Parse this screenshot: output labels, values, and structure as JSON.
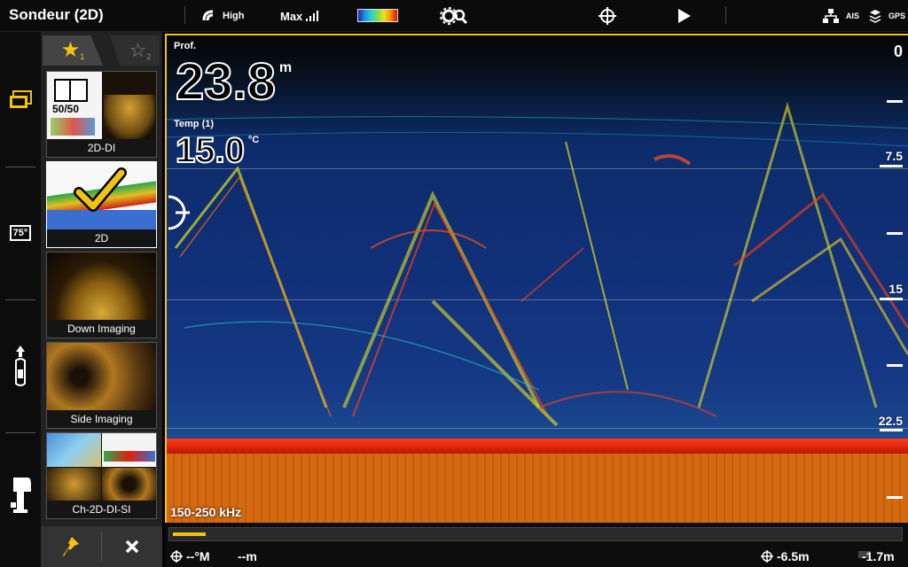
{
  "app": {
    "title": "Sondeur (2D)",
    "sensitivity": "High",
    "range_mode": "Max",
    "ais_label": "AIS",
    "gps_label": "GPS"
  },
  "favorites": {
    "tab1_number": "1",
    "tab2_number": "2",
    "tiles": [
      {
        "label": "2D-DI",
        "overlay": "50/50"
      },
      {
        "label": "2D"
      },
      {
        "label": "Down Imaging"
      },
      {
        "label": "Side Imaging"
      },
      {
        "label": "Ch-2D-DI-SI"
      }
    ]
  },
  "rail": {
    "temp_badge": "75°"
  },
  "sonar": {
    "depth_label": "Prof.",
    "depth_value": "23.8",
    "depth_unit": "m",
    "temp_label": "Temp (1)",
    "temp_value": "15.0",
    "temp_unit": "°C",
    "frequency": "150-250 kHz",
    "scale": [
      "0",
      "7.5",
      "15",
      "22.5"
    ]
  },
  "status": {
    "cursor_depth": "--°M",
    "cursor_dist": "--m",
    "offset1": "-6.5m",
    "offset2": "-1.7m",
    "progress_fraction": 0.045
  },
  "colors": {
    "accent": "#f2c30f"
  }
}
